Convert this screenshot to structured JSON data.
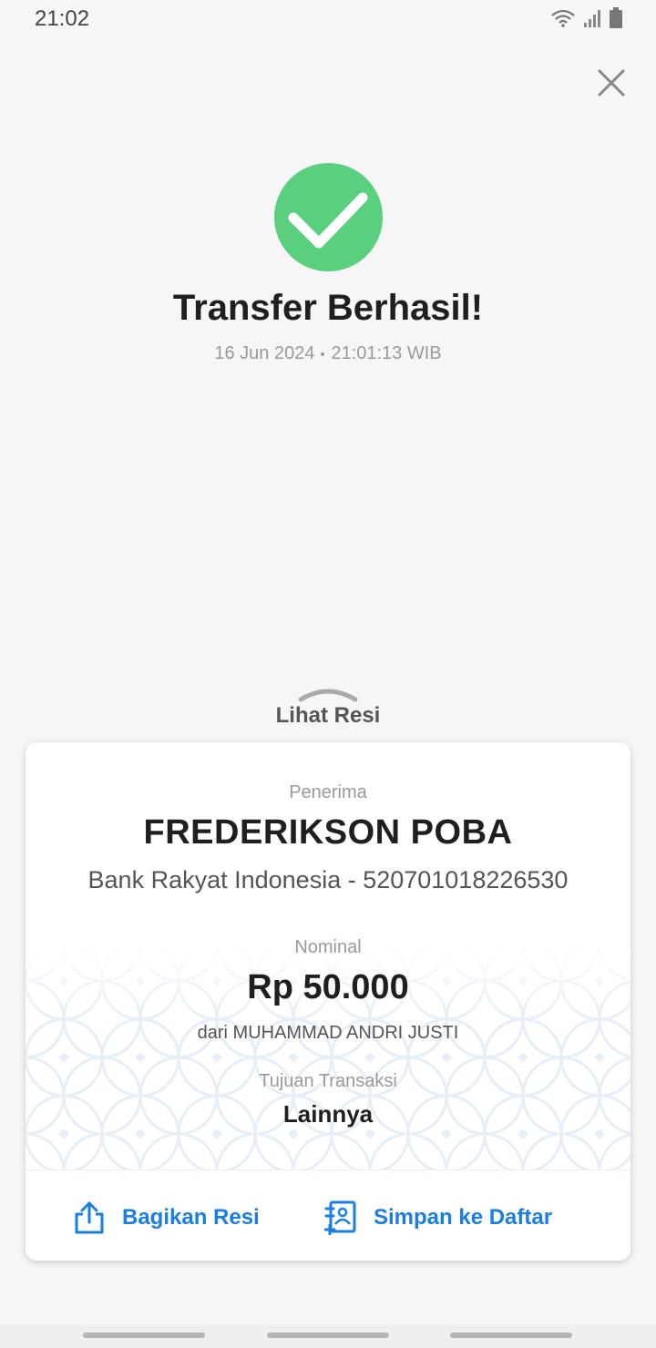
{
  "status_bar": {
    "time": "21:02",
    "icons": [
      "wifi-icon",
      "signal-icon",
      "battery-icon"
    ]
  },
  "header": {
    "close_icon": "close-icon"
  },
  "result": {
    "icon": "check-circle-icon",
    "title": "Transfer Berhasil!",
    "date": "16 Jun 2024",
    "time": "21:01:13 WIB"
  },
  "receipt_toggle": {
    "icon": "chevron-up-icon",
    "label": "Lihat Resi"
  },
  "receipt": {
    "recipient_label": "Penerima",
    "recipient_name": "FREDERIKSON POBA",
    "bank_account": "Bank Rakyat Indonesia - 520701018226530",
    "amount_label": "Nominal",
    "amount": "Rp 50.000",
    "from": "dari MUHAMMAD ANDRI JUSTI",
    "purpose_label": "Tujuan Transaksi",
    "purpose": "Lainnya"
  },
  "actions": {
    "share_icon": "share-icon",
    "share_label": "Bagikan Resi",
    "save_icon": "contact-add-icon",
    "save_label": "Simpan ke Daftar"
  },
  "colors": {
    "success": "#5ad07f",
    "accent": "#1a7fe0",
    "background": "#f6f6f6"
  }
}
